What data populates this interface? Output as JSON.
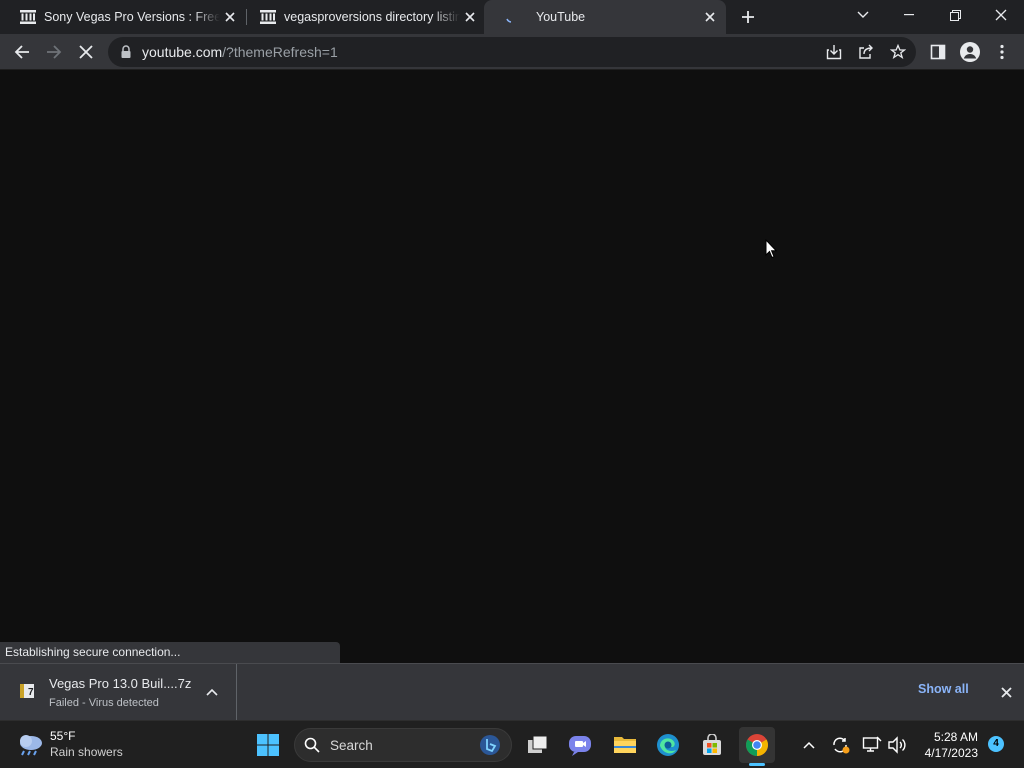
{
  "tabs": [
    {
      "title": "Sony Vegas Pro Versions : Free Do",
      "icon": "archive-icon"
    },
    {
      "title": "vegasproversions directory listing",
      "icon": "archive-icon"
    },
    {
      "title": "YouTube",
      "icon": "loading-spinner-icon"
    }
  ],
  "address_bar": {
    "host": "youtube.com",
    "path": "/?themeRefresh=1"
  },
  "status_bubble": "Establishing secure connection...",
  "download": {
    "filename": "Vegas Pro 13.0 Buil....7z",
    "status": "Failed - Virus detected",
    "show_all_label": "Show all"
  },
  "taskbar": {
    "weather_temp": "55°F",
    "weather_condition": "Rain showers",
    "search_label": "Search",
    "time": "5:28 AM",
    "date": "4/17/2023",
    "notification_count": "4"
  },
  "colors": {
    "accent": "#8ab4f8",
    "taskbar_accent": "#4cc2ff"
  }
}
